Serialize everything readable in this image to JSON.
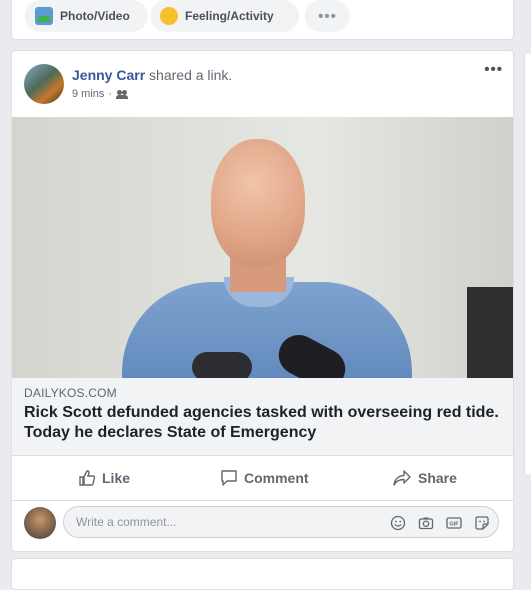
{
  "composer": {
    "photo_label": "Photo/Video",
    "feeling_label": "Feeling/Activity",
    "more_label": "•••"
  },
  "post": {
    "author": "Jenny Carr",
    "action_text": "shared a link.",
    "time": "9 mins",
    "meta_sep": "·",
    "menu_label": "•••",
    "link": {
      "domain": "DAILYKOS.COM",
      "headline": "Rick Scott defunded agencies tasked with overseeing red tide. Today he declares State of Emergency",
      "info_label": "i"
    },
    "actions": {
      "like": "Like",
      "comment": "Comment",
      "share": "Share"
    },
    "comment_box": {
      "placeholder": "Write a comment..."
    }
  }
}
